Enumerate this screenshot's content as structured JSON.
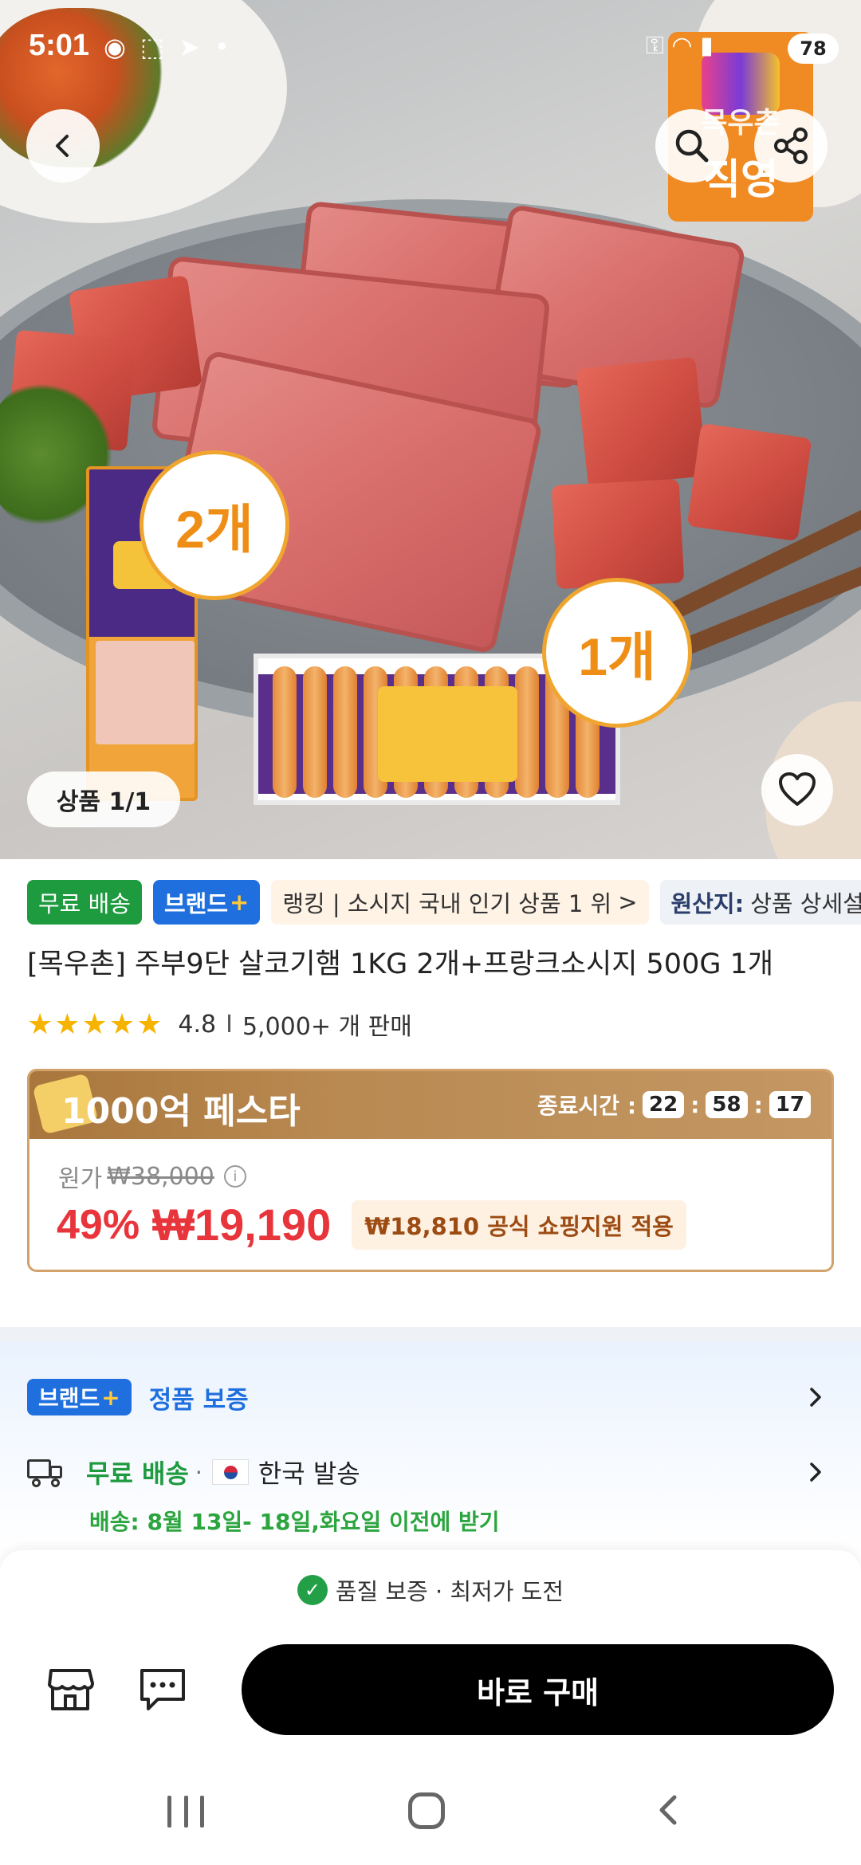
{
  "status_bar": {
    "time": "5:01",
    "battery": "78",
    "icons": [
      "notification-icon",
      "screenshot-icon",
      "telegram-icon",
      "dot-icon",
      "key-icon",
      "wifi-icon",
      "signal-icon"
    ]
  },
  "hero": {
    "brand_tile_name": "목우촌",
    "brand_tile_sub": "직영",
    "badge_two": "2개",
    "badge_one": "1개",
    "image_counter": "상품 1/1"
  },
  "tags": {
    "free_shipping": "무료 배송",
    "brand": "브랜드",
    "brand_plus": "+",
    "ranking": "랭킹 | 소시지 국내 인기 상품 1 위",
    "ranking_arrow": ">",
    "origin_label": "원산지:",
    "origin_value": "상품 상세설"
  },
  "product": {
    "title": "[목우촌] 주부9단 살코기햄 1KG 2개+프랑크소시지 500G 1개",
    "rating": "4.8",
    "sold": "5,000+ 개 판매",
    "stars": 4.8
  },
  "festa": {
    "title": "1000억 페스타",
    "timer_label": "종료시간 :",
    "hours": "22",
    "minutes": "58",
    "seconds": "17",
    "sep": ":",
    "original_label": "원가",
    "original_price": "₩38,000",
    "discount": "49%",
    "price": "₩19,190",
    "support": "₩18,810 공식 쇼핑지원 적용"
  },
  "guarantee": {
    "brand": "브랜드",
    "plus": "+",
    "text": "정품 보증"
  },
  "shipping": {
    "free": "무료 배송",
    "dot": "·",
    "origin": "한국 발송",
    "date": "배송: 8월 13일- 18일,화요일 이전에 받기"
  },
  "bottom": {
    "quality": "품질 보증 · 최저가 도전",
    "buy_now": "바로 구매"
  },
  "colors": {
    "accent_red": "#e8343b",
    "brand_blue": "#1f6fde",
    "green": "#1e9a3f",
    "festa_gold": "#b98a52"
  }
}
